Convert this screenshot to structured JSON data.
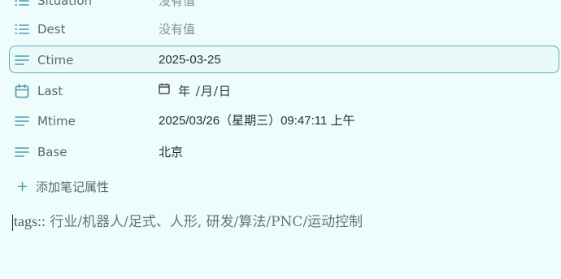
{
  "properties": [
    {
      "name": "Situation",
      "value": "没有值",
      "empty": true,
      "icon": "list-icon"
    },
    {
      "name": "Dest",
      "value": "没有值",
      "empty": true,
      "icon": "list-icon"
    },
    {
      "name": "Ctime",
      "value": "2025-03-25",
      "empty": false,
      "icon": "text-lines-icon"
    },
    {
      "name": "Last",
      "value": "年 /月/日",
      "empty": false,
      "icon": "calendar-icon"
    },
    {
      "name": "Mtime",
      "value": "2025/03/26（星期三）09:47:11 上午",
      "empty": false,
      "icon": "text-lines-icon"
    },
    {
      "name": "Base",
      "value": "北京",
      "empty": false,
      "icon": "text-lines-icon"
    }
  ],
  "add_property": {
    "label": "添加笔记属性"
  },
  "tags": {
    "key": "tags::",
    "value": " 行业/机器人/足式、人形, 研发/算法/PNC/运动控制"
  },
  "colors": {
    "accent": "#4a9bb0",
    "active_border": "#5eaab5",
    "background": "#eefcfc"
  }
}
